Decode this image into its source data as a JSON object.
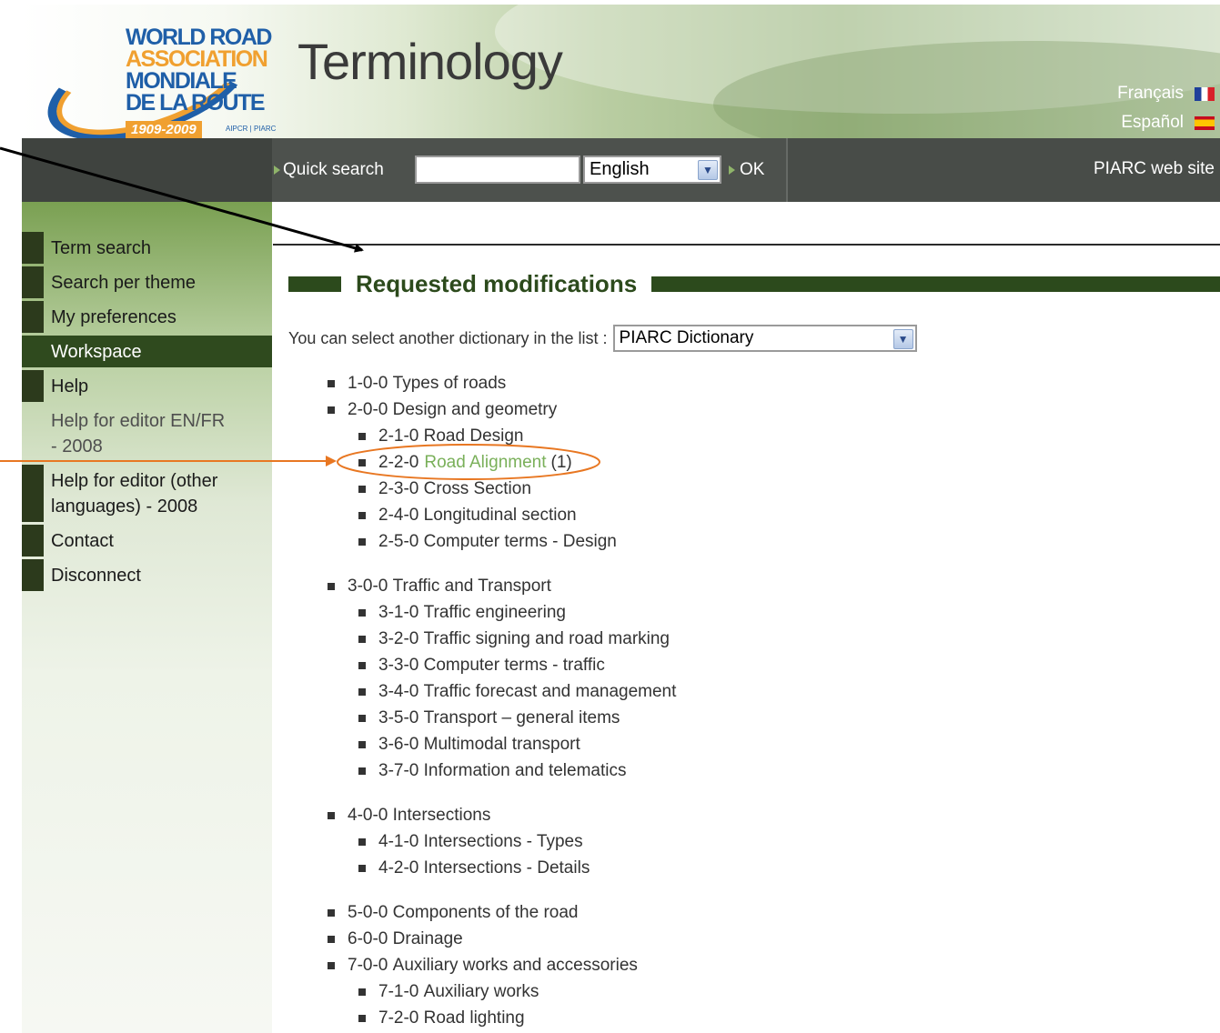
{
  "header": {
    "logo": {
      "line1": "WORLD ROAD",
      "line2": "ASSOCIATION",
      "line3": "MONDIALE",
      "line4": "DE LA ROUTE",
      "years": "1909-2009",
      "small": "AIPCR | PIARC"
    },
    "title": "Terminology",
    "languages": [
      {
        "label": "Français",
        "flag": "flag-fr-icon"
      },
      {
        "label": "Español",
        "flag": "flag-es-icon"
      }
    ]
  },
  "navbar": {
    "quick_search_label": "Quick search",
    "search_value": "",
    "language_selected": "English",
    "ok_label": "OK",
    "piarc_link": "PIARC web site"
  },
  "sidebar": {
    "items": [
      {
        "label": "Term search"
      },
      {
        "label": "Search per theme"
      },
      {
        "label": "My preferences"
      },
      {
        "label": "Workspace"
      },
      {
        "label": "Help"
      },
      {
        "label": "Help for editor EN/FR - 2008"
      },
      {
        "label": "Help for editor (other languages) - 2008"
      },
      {
        "label": "Contact"
      },
      {
        "label": "Disconnect"
      }
    ]
  },
  "main": {
    "section_title": "Requested modifications",
    "dictionary_prompt": "You can select another dictionary in the list :",
    "dictionary_selected": "PIARC Dictionary",
    "tree": [
      {
        "code": "1-0-0",
        "label": "Types of roads"
      },
      {
        "code": "2-0-0",
        "label": "Design and geometry",
        "children": [
          {
            "code": "2-1-0",
            "label": "Road Design"
          },
          {
            "code": "2-2-0",
            "label": "Road Alignment",
            "count": "(1)"
          },
          {
            "code": "2-3-0",
            "label": "Cross Section"
          },
          {
            "code": "2-4-0",
            "label": "Longitudinal section"
          },
          {
            "code": "2-5-0",
            "label": "Computer terms - Design"
          }
        ]
      },
      {
        "code": "3-0-0",
        "label": "Traffic and Transport",
        "children": [
          {
            "code": "3-1-0",
            "label": "Traffic engineering"
          },
          {
            "code": "3-2-0",
            "label": "Traffic signing and road marking"
          },
          {
            "code": "3-3-0",
            "label": "Computer terms - traffic"
          },
          {
            "code": "3-4-0",
            "label": "Traffic forecast and management"
          },
          {
            "code": "3-5-0",
            "label": "Transport – general items"
          },
          {
            "code": "3-6-0",
            "label": "Multimodal transport"
          },
          {
            "code": "3-7-0",
            "label": "Information and telematics"
          }
        ]
      },
      {
        "code": "4-0-0",
        "label": "Intersections",
        "children": [
          {
            "code": "4-1-0",
            "label": "Intersections - Types"
          },
          {
            "code": "4-2-0",
            "label": "Intersections - Details"
          }
        ]
      },
      {
        "code": "5-0-0",
        "label": "Components of the road"
      },
      {
        "code": "6-0-0",
        "label": "Drainage"
      },
      {
        "code": "7-0-0",
        "label": "Auxiliary works and accessories",
        "children": [
          {
            "code": "7-1-0",
            "label": "Auxiliary works"
          },
          {
            "code": "7-2-0",
            "label": "Road lighting"
          }
        ]
      }
    ]
  },
  "colors": {
    "accent_green": "#2c4a1c",
    "link_green": "#7ab05a",
    "nav_dark": "#484c48",
    "annotation_orange": "#e87722"
  }
}
